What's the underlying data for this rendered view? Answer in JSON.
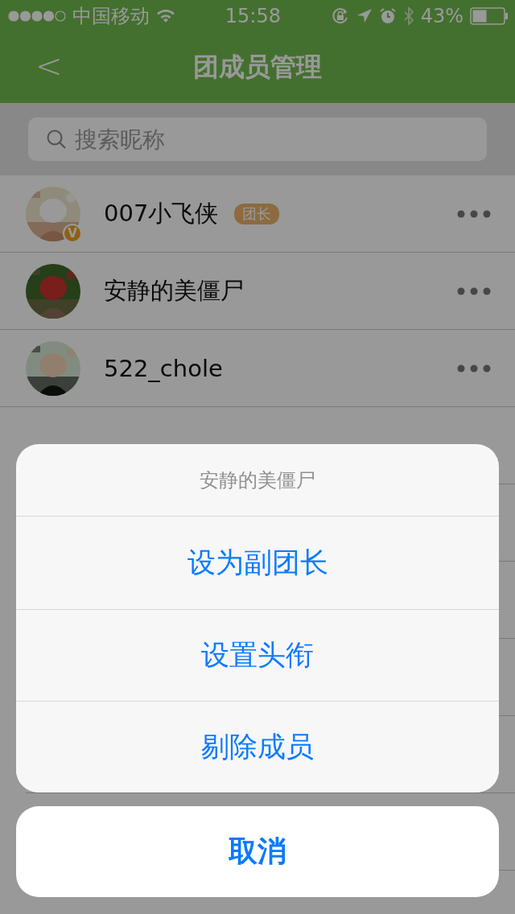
{
  "status_bar": {
    "carrier": "中国移动",
    "time": "15:58",
    "battery": "43%"
  },
  "nav": {
    "back": "<",
    "title": "团成员管理"
  },
  "search": {
    "placeholder": "搜索昵称"
  },
  "members": [
    {
      "name": "007小飞侠",
      "role": "团长",
      "verified": true,
      "badge_letter": "V"
    },
    {
      "name": "安静的美僵尸",
      "verified": false
    },
    {
      "name": "522_chole",
      "verified": false
    }
  ],
  "action_sheet": {
    "title": "安静的美僵尸",
    "actions": [
      "设为副团长",
      "设置头衔",
      "剔除成员"
    ],
    "cancel": "取消"
  }
}
